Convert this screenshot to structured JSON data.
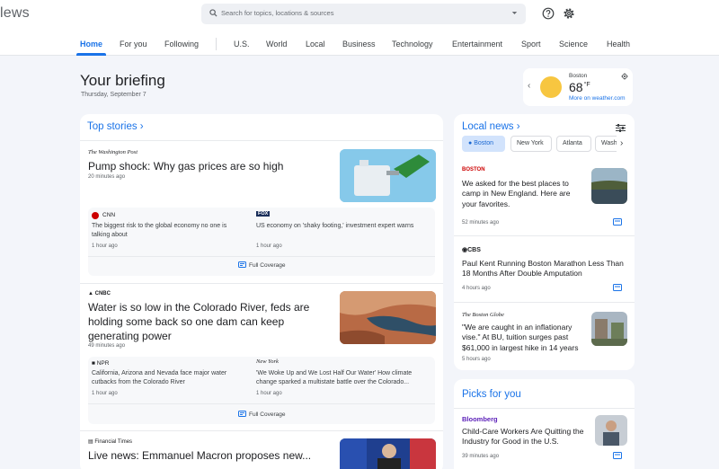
{
  "app": {
    "brand": "lews"
  },
  "search": {
    "placeholder": "Search for topics, locations & sources"
  },
  "nav": {
    "items": [
      "Home",
      "For you",
      "Following",
      "U.S.",
      "World",
      "Local",
      "Business",
      "Technology",
      "Entertainment",
      "Sport",
      "Science",
      "Health"
    ]
  },
  "briefing": {
    "title": "Your briefing",
    "date": "Thursday, September 7"
  },
  "weather": {
    "city": "Boston",
    "temp": "68",
    "unit": "°F",
    "link": "More on weather.com"
  },
  "top_stories": {
    "title": "Top stories",
    "stories": [
      {
        "source": "The Washington Post",
        "headline": "Pump shock: Why gas prices are so high",
        "time": "20 minutes ago",
        "related": [
          {
            "source": "CNN",
            "title": "The biggest risk to the global economy no one is talking about",
            "time": "1 hour ago"
          },
          {
            "source": "FOX",
            "title": "US economy on 'shaky footing,' investment expert warns",
            "time": "1 hour ago"
          }
        ],
        "coverage": "Full Coverage"
      },
      {
        "source": "CNBC",
        "headline": "Water is so low in the Colorado River, feds are holding some back so one dam can keep generating power",
        "time": "49 minutes ago",
        "related": [
          {
            "source": "NPR",
            "title": "California, Arizona and Nevada face major water cutbacks from the Colorado River",
            "time": "1 hour ago"
          },
          {
            "source": "New York",
            "title": "'We Woke Up and We Lost Half Our Water' How climate change sparked a multistate battle over the Colorado...",
            "time": "1 hour ago"
          }
        ],
        "coverage": "Full Coverage"
      },
      {
        "source": "Financial Times",
        "headline": "Live news: Emmanuel Macron proposes new..."
      }
    ]
  },
  "local_news": {
    "title": "Local news",
    "chips": [
      "Boston",
      "New York",
      "Atlanta",
      "Wash"
    ],
    "items": [
      {
        "source": "BOSTON",
        "headline": "We asked for the best places to camp in New England. Here are your favorites.",
        "time": "52 minutes ago"
      },
      {
        "source": "CBS",
        "headline": "Paul Kent Running Boston Marathon Less Than 18 Months After Double Amputation",
        "time": "4 hours ago"
      },
      {
        "source": "The Boston Globe",
        "headline": "\"We are caught in an inflationary vise.\" At BU, tuition surges past $61,000 in largest hike in 14 years",
        "time": "5 hours ago"
      }
    ]
  },
  "picks": {
    "title": "Picks for you",
    "items": [
      {
        "source": "Bloomberg",
        "headline": "Child-Care Workers Are Quitting the Industry for Good in the U.S.",
        "time": "39 minutes ago"
      }
    ]
  },
  "colors": {
    "accent": "#1a73e8",
    "background": "#f3f5fa",
    "chip_active": "#d2e3fc"
  },
  "icons": [
    "search-icon",
    "dropdown-icon",
    "help-icon",
    "settings-icon",
    "location-pin-icon",
    "full-coverage-icon",
    "tune-icon",
    "chevron-right-icon"
  ]
}
